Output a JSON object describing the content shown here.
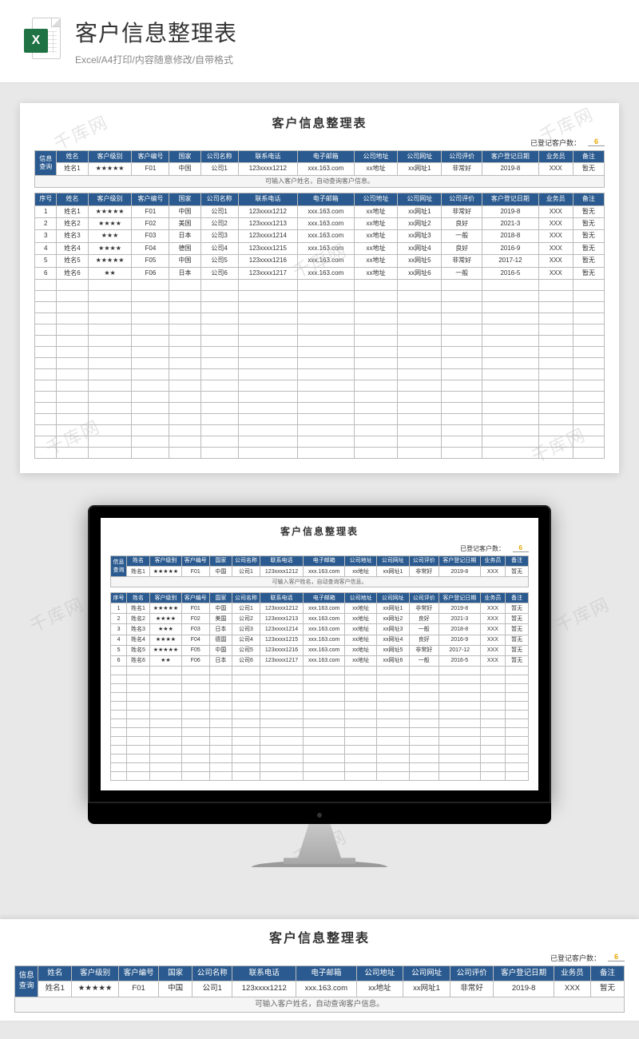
{
  "header": {
    "title": "客户信息整理表",
    "subtitle": "Excel/A4打印/内容随意修改/自带格式",
    "icon_letter": "X"
  },
  "watermark": "千库网",
  "sheet": {
    "title": "客户信息整理表",
    "count_label": "已登记客户数：",
    "count_value": "6",
    "hint": "可输入客户姓名，自动查询客户信息。",
    "query_label": "信息查询",
    "columns": [
      "序号",
      "姓名",
      "客户级别",
      "客户编号",
      "国家",
      "公司名称",
      "联系电话",
      "电子邮箱",
      "公司地址",
      "公司网址",
      "公司评价",
      "客户登记日期",
      "业务员",
      "备注"
    ],
    "query_row": [
      "姓名1",
      "★★★★★",
      "F01",
      "中国",
      "公司1",
      "123xxxx1212",
      "xxx.163.com",
      "xx地址",
      "xx网址1",
      "非常好",
      "2019-8",
      "XXX",
      "暂无"
    ],
    "rows": [
      [
        "1",
        "姓名1",
        "★★★★★",
        "F01",
        "中国",
        "公司1",
        "123xxxx1212",
        "xxx.163.com",
        "xx地址",
        "xx网址1",
        "非常好",
        "2019-8",
        "XXX",
        "暂无"
      ],
      [
        "2",
        "姓名2",
        "★★★★",
        "F02",
        "美国",
        "公司2",
        "123xxxx1213",
        "xxx.163.com",
        "xx地址",
        "xx网址2",
        "良好",
        "2021-3",
        "XXX",
        "暂无"
      ],
      [
        "3",
        "姓名3",
        "★★★",
        "F03",
        "日本",
        "公司3",
        "123xxxx1214",
        "xxx.163.com",
        "xx地址",
        "xx网址3",
        "一般",
        "2018-8",
        "XXX",
        "暂无"
      ],
      [
        "4",
        "姓名4",
        "★★★★",
        "F04",
        "德国",
        "公司4",
        "123xxxx1215",
        "xxx.163.com",
        "xx地址",
        "xx网址4",
        "良好",
        "2016-9",
        "XXX",
        "暂无"
      ],
      [
        "5",
        "姓名5",
        "★★★★★",
        "F05",
        "中国",
        "公司5",
        "123xxxx1216",
        "xxx.163.com",
        "xx地址",
        "xx网址5",
        "非常好",
        "2017-12",
        "XXX",
        "暂无"
      ],
      [
        "6",
        "姓名6",
        "★★",
        "F06",
        "日本",
        "公司6",
        "123xxxx1217",
        "xxx.163.com",
        "xx地址",
        "xx网址6",
        "一般",
        "2016-5",
        "XXX",
        "暂无"
      ]
    ],
    "empty_rows": 16,
    "empty_rows_small": 13
  }
}
